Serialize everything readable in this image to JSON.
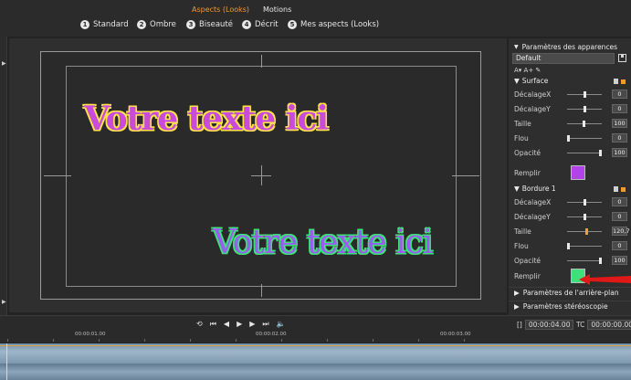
{
  "tabs": {
    "looks": "Aspects (Looks)",
    "motions": "Motions"
  },
  "look_presets": [
    {
      "num": "1",
      "label": "Standard"
    },
    {
      "num": "2",
      "label": "Ombre"
    },
    {
      "num": "3",
      "label": "Biseauté"
    },
    {
      "num": "4",
      "label": "Décrit"
    },
    {
      "num": "5",
      "label": "Mes aspects (Looks)"
    }
  ],
  "preview": {
    "text_top": "Votre texte ici",
    "text_bottom": "Votre texte ici"
  },
  "panel": {
    "title": "Paramètres des apparences",
    "preset": "Default",
    "surface": {
      "title": "Surface",
      "rows": [
        {
          "label": "DécalageX",
          "value": "0"
        },
        {
          "label": "DécalageY",
          "value": "0"
        },
        {
          "label": "Taille",
          "value": "100"
        },
        {
          "label": "Flou",
          "value": "0"
        },
        {
          "label": "Opacité",
          "value": "100"
        }
      ],
      "fill_label": "Remplir",
      "fill_color": "#b044e8"
    },
    "border": {
      "title": "Bordure 1",
      "rows": [
        {
          "label": "DécalageX",
          "value": "0"
        },
        {
          "label": "DécalageY",
          "value": "0"
        },
        {
          "label": "Taille",
          "value": "120,7"
        },
        {
          "label": "Flou",
          "value": "0"
        },
        {
          "label": "Opacité",
          "value": "100"
        }
      ],
      "fill_label": "Remplir",
      "fill_color": "#3fe07a"
    },
    "background_title": "Paramètres de l'arrière-plan",
    "stereo_title": "Paramètres stéréoscopie"
  },
  "timeline": {
    "ticks": [
      "00:00:01.00",
      "00:00:02.00",
      "00:00:03.00"
    ],
    "duration": "00:00:04.00",
    "duration_label": "[]",
    "timecode_label": "TC",
    "timecode": "00:00:00.00"
  }
}
